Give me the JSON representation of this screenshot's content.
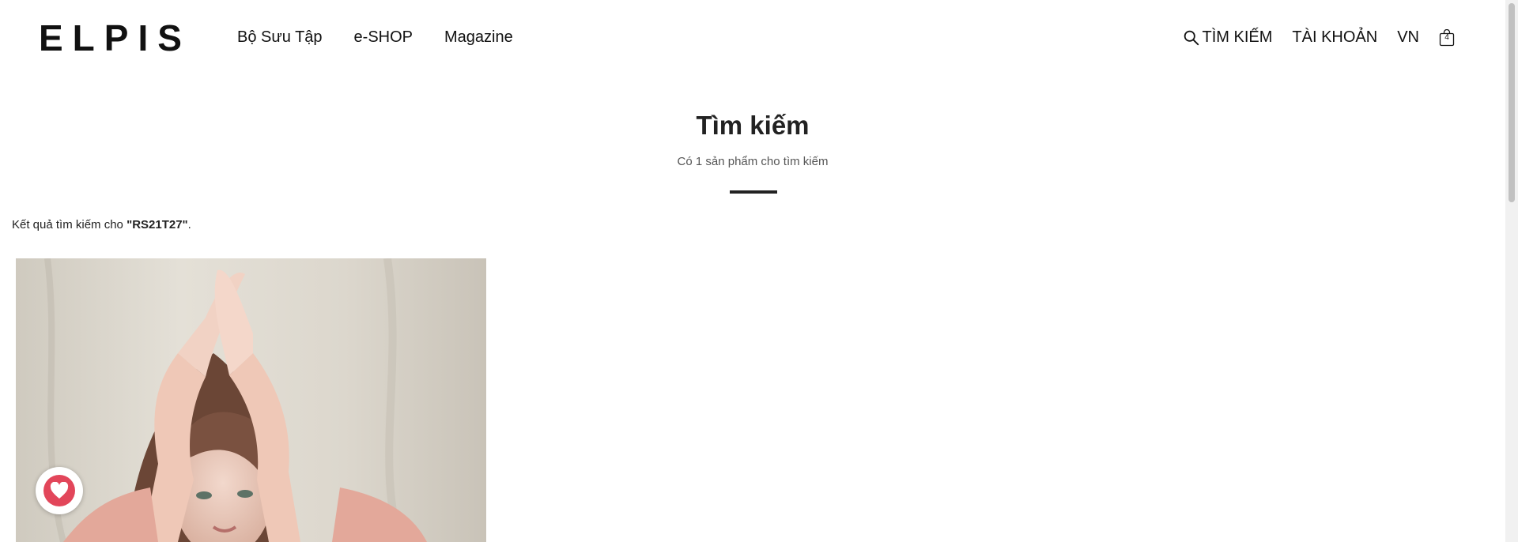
{
  "brand": {
    "logo": "ELPIS"
  },
  "nav": {
    "items": [
      "Bộ Sưu Tập",
      "e-SHOP",
      "Magazine"
    ]
  },
  "header_right": {
    "search_label": "TÌM KIẾM",
    "account_label": "TÀI KHOẢN",
    "lang_label": "VN",
    "cart_count": "4"
  },
  "page": {
    "title": "Tìm kiếm",
    "subtitle": "Có 1 sản phẩm cho tìm kiếm"
  },
  "result": {
    "prefix": "Kết quả tìm kiếm cho ",
    "query": "\"RS21T27\"",
    "suffix": "."
  },
  "colors": {
    "wishlist_button": "#e2465a",
    "divider": "#222222"
  },
  "icons": {
    "search": "search-icon",
    "cart": "shopping-bag-icon",
    "wishlist": "heart-icon"
  }
}
